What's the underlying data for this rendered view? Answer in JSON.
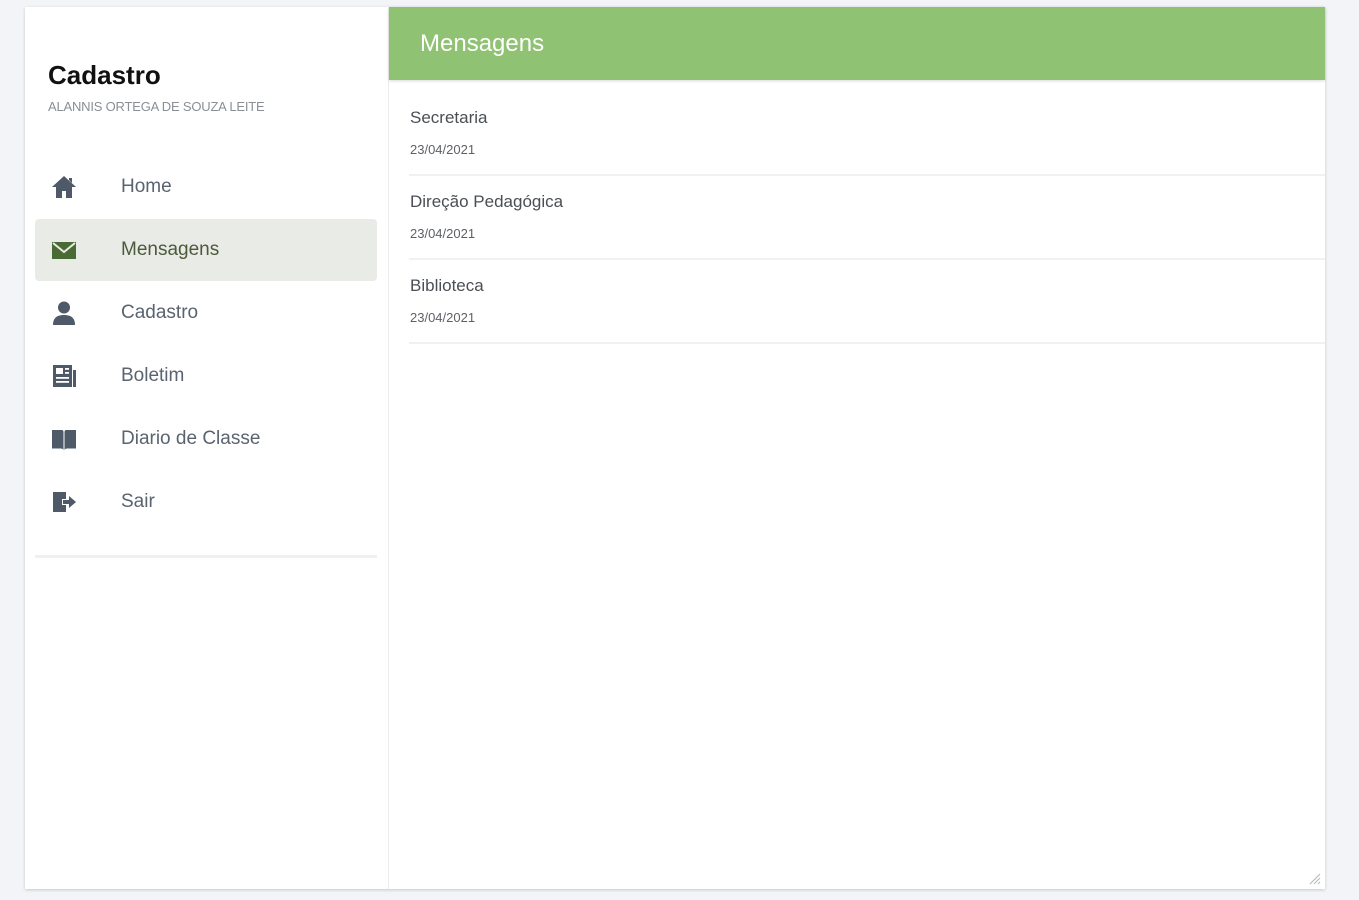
{
  "sidebar": {
    "title": "Cadastro",
    "subtitle": "ALANNIS ORTEGA DE SOUZA LEITE",
    "items": [
      {
        "label": "Home",
        "icon": "home-icon"
      },
      {
        "label": "Mensagens",
        "icon": "envelope-icon",
        "active": true
      },
      {
        "label": "Cadastro",
        "icon": "user-icon"
      },
      {
        "label": "Boletim",
        "icon": "newspaper-icon"
      },
      {
        "label": "Diario de Classe",
        "icon": "book-open-icon"
      },
      {
        "label": "Sair",
        "icon": "sign-out-icon"
      }
    ]
  },
  "main": {
    "title": "Mensagens",
    "messages": [
      {
        "sender": "Secretaria",
        "date": "23/04/2021"
      },
      {
        "sender": "Direção Pedagógica",
        "date": "23/04/2021"
      },
      {
        "sender": "Biblioteca",
        "date": "23/04/2021"
      }
    ]
  },
  "colors": {
    "accent": "#8fc273",
    "active_bg": "#e9ebe6",
    "icon": "#4e5a68",
    "active_icon": "#4b6b34"
  }
}
